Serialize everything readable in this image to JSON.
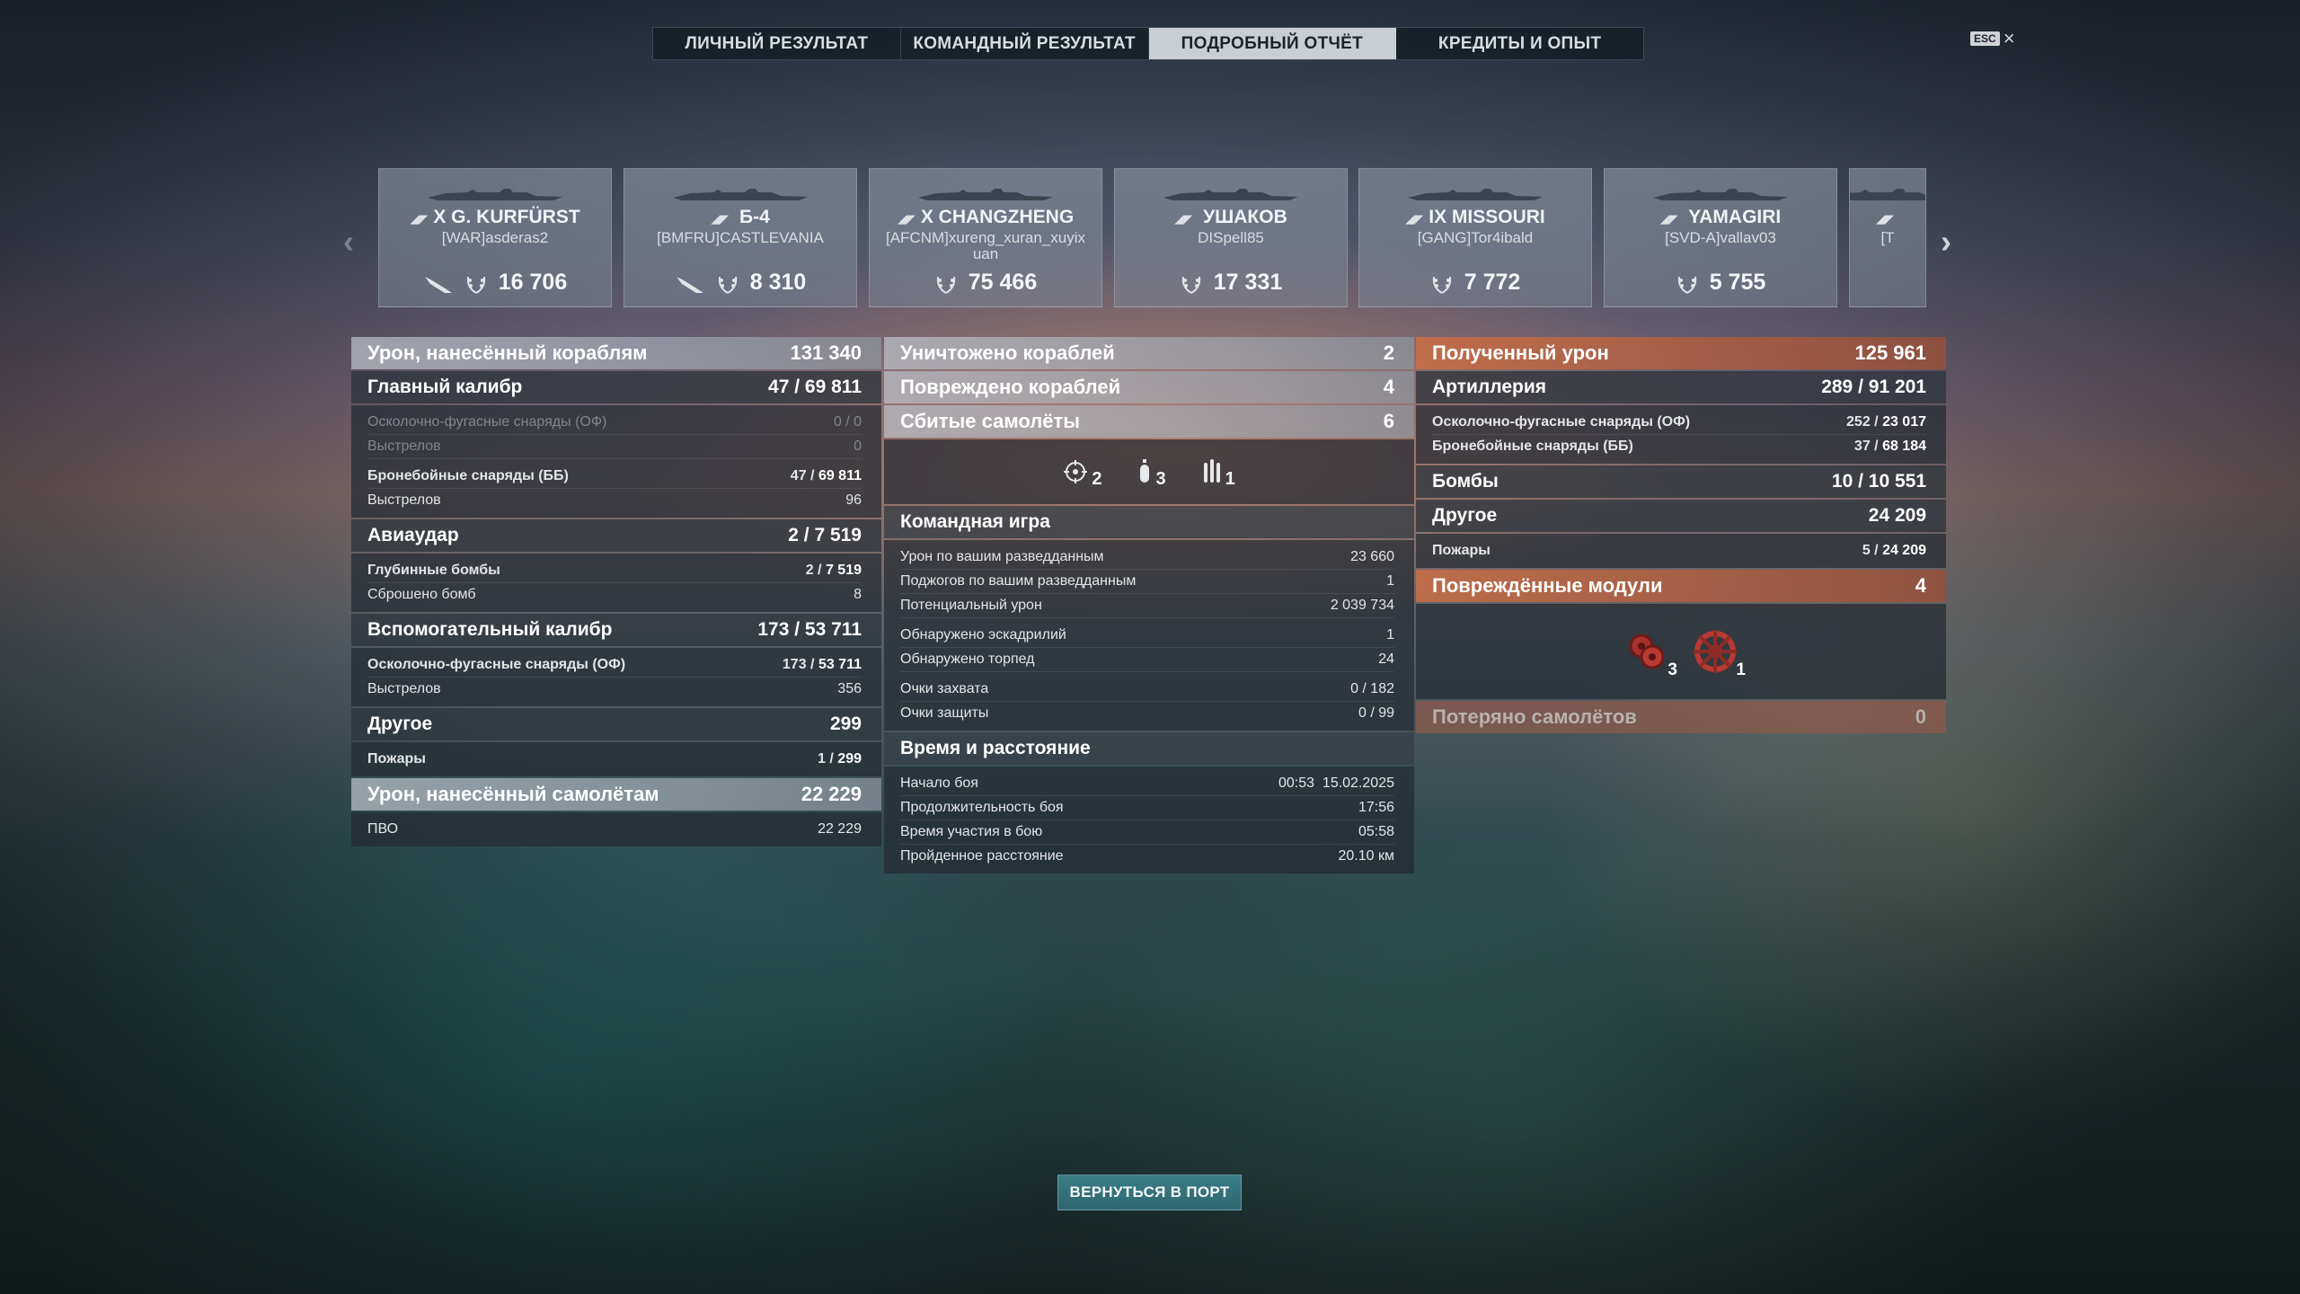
{
  "tabs": [
    {
      "label": "ЛИЧНЫЙ РЕЗУЛЬТАТ",
      "active": false
    },
    {
      "label": "КОМАНДНЫЙ РЕЗУЛЬТАТ",
      "active": false
    },
    {
      "label": "ПОДРОБНЫЙ ОТЧЁТ",
      "active": true
    },
    {
      "label": "КРЕДИТЫ И ОПЫТ",
      "active": false
    }
  ],
  "esc_label": "ESC",
  "ships": [
    {
      "tier": "X",
      "name": "G. KURFÜRST",
      "player": "[WAR]asderas2",
      "damage": "16 706",
      "ribbon": true
    },
    {
      "tier": "",
      "name": "Б-4",
      "player": "[BMFRU]CASTLEVANIA",
      "damage": "8 310",
      "ribbon": true
    },
    {
      "tier": "X",
      "name": "CHANGZHENG",
      "player": "[AFCNM]xureng_xuran_xuyixuan",
      "damage": "75 466",
      "ribbon": false
    },
    {
      "tier": "",
      "name": "УШАКОВ",
      "player": "DISpell85",
      "damage": "17 331",
      "ribbon": false
    },
    {
      "tier": "IX",
      "name": "MISSOURI",
      "player": "[GANG]Tor4ibald",
      "damage": "7 772",
      "ribbon": false
    },
    {
      "tier": "",
      "name": "YAMAGIRI",
      "player": "[SVD-A]vallav03",
      "damage": "5 755",
      "ribbon": false
    },
    {
      "tier": "",
      "name": "",
      "player": "[T",
      "damage": "",
      "ribbon": false
    }
  ],
  "col1": {
    "damage_ships": {
      "label": "Урон, нанесённый кораблям",
      "value": "131 340"
    },
    "main_caliber": {
      "label": "Главный калибр",
      "hits": "47",
      "total": "69 811"
    },
    "he": {
      "label": "Осколочно-фугасные снаряды (ОФ)",
      "value": "0 / 0"
    },
    "he_shots": {
      "label": "Выстрелов",
      "value": "0"
    },
    "ap": {
      "label": "Бронебойные снаряды (ББ)",
      "hits": "47",
      "total": "69 811"
    },
    "ap_shots": {
      "label": "Выстрелов",
      "value": "96"
    },
    "airstrike": {
      "label": "Авиаудар",
      "hits": "2",
      "total": "7 519"
    },
    "depth": {
      "label": "Глубинные бомбы",
      "hits": "2",
      "total": "7 519"
    },
    "bombs_dropped": {
      "label": "Сброшено бомб",
      "value": "8"
    },
    "secondary": {
      "label": "Вспомогательный калибр",
      "hits": "173",
      "total": "53 711"
    },
    "sec_he": {
      "label": "Осколочно-фугасные снаряды (ОФ)",
      "hits": "173",
      "total": "53 711"
    },
    "sec_shots": {
      "label": "Выстрелов",
      "value": "356"
    },
    "other": {
      "label": "Другое",
      "value": "299"
    },
    "fires": {
      "label": "Пожары",
      "hits": "1",
      "total": "299"
    },
    "damage_planes": {
      "label": "Урон, нанесённый самолётам",
      "value": "22 229"
    },
    "aa": {
      "label": "ПВО",
      "value": "22 229"
    }
  },
  "col2": {
    "destroyed": {
      "label": "Уничтожено кораблей",
      "value": "2"
    },
    "damaged": {
      "label": "Повреждено кораблей",
      "value": "4"
    },
    "planes_shot": {
      "label": "Сбитые самолёты",
      "value": "6"
    },
    "plane_counts": {
      "fighter": "2",
      "bomber": "3",
      "torpedo": "1"
    },
    "teamplay": {
      "label": "Командная игра"
    },
    "spotting_dmg": {
      "label": "Урон по вашим разведданным",
      "value": "23 660"
    },
    "spotting_fires": {
      "label": "Поджогов по вашим разведданным",
      "value": "1"
    },
    "potential": {
      "label": "Потенциальный урон",
      "value": "2 039 734"
    },
    "squadrons": {
      "label": "Обнаружено эскадрилий",
      "value": "1"
    },
    "torps": {
      "label": "Обнаружено торпед",
      "value": "24"
    },
    "capture": {
      "label": "Очки захвата",
      "value": "0 / 182"
    },
    "defense": {
      "label": "Очки защиты",
      "value": "0 / 99"
    },
    "time": {
      "label": "Время и расстояние"
    },
    "start": {
      "label": "Начало боя",
      "value": "00:53  15.02.2025"
    },
    "duration": {
      "label": "Продолжительность боя",
      "value": "17:56"
    },
    "participation": {
      "label": "Время участия в бою",
      "value": "05:58"
    },
    "distance": {
      "label": "Пройденное расстояние",
      "value": "20.10 км"
    }
  },
  "col3": {
    "received": {
      "label": "Полученный урон",
      "value": "125 961"
    },
    "artillery": {
      "label": "Артиллерия",
      "hits": "289",
      "total": "91 201"
    },
    "he": {
      "label": "Осколочно-фугасные снаряды (ОФ)",
      "hits": "252",
      "total": "23 017"
    },
    "ap": {
      "label": "Бронебойные снаряды (ББ)",
      "hits": "37",
      "total": "68 184"
    },
    "bombs": {
      "label": "Бомбы",
      "hits": "10",
      "total": "10 551"
    },
    "other": {
      "label": "Другое",
      "value": "24 209"
    },
    "fires": {
      "label": "Пожары",
      "hits": "5",
      "total": "24 209"
    },
    "modules": {
      "label": "Повреждённые модули",
      "value": "4"
    },
    "module_counts": {
      "engine": "3",
      "steering": "1"
    },
    "planes_lost": {
      "label": "Потеряно самолётов",
      "value": "0"
    }
  },
  "return_button": "ВЕРНУТЬСЯ В ПОРТ"
}
